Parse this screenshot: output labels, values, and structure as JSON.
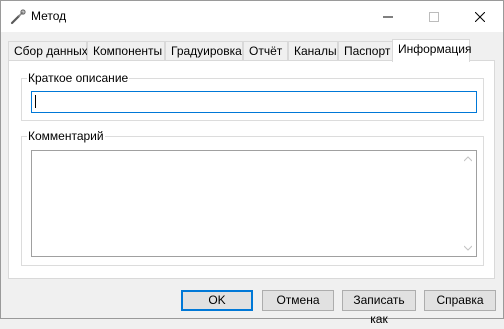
{
  "window": {
    "title": "Метод",
    "controls": {
      "minimize": "minimize",
      "maximize": "maximize",
      "close": "close"
    }
  },
  "tabs": [
    {
      "label": "Сбор данных",
      "active": false
    },
    {
      "label": "Компоненты",
      "active": false
    },
    {
      "label": "Градуировка",
      "active": false
    },
    {
      "label": "Отчёт",
      "active": false
    },
    {
      "label": "Каналы",
      "active": false
    },
    {
      "label": "Паспорт",
      "active": false
    },
    {
      "label": "Информация",
      "active": true
    }
  ],
  "info": {
    "short_description": {
      "label": "Краткое описание",
      "value": ""
    },
    "comment": {
      "label": "Комментарий",
      "value": ""
    }
  },
  "buttons": {
    "ok": "OK",
    "cancel": "Отмена",
    "save_as": "Записать как",
    "help": "Справка"
  },
  "colors": {
    "focus_border": "#0078d7",
    "window_bg": "#f0f0f0",
    "panel_bg": "#ffffff"
  }
}
